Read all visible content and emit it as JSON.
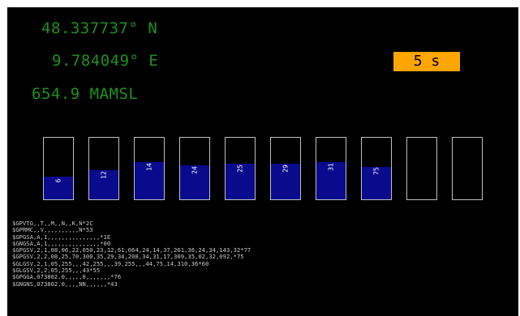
{
  "position": {
    "latitude": "48.337737° N",
    "longitude": "9.784049° E",
    "altitude": "654.9 MAMSL"
  },
  "timer": "5 s",
  "colors": {
    "background": "#000000",
    "coords": "#1f8f1f",
    "timer_bg": "#ffa500",
    "bar_fill": "#0a0a8c",
    "bar_border": "#bfbfbf",
    "nmea_text": "#c8c8c8"
  },
  "satellites": [
    {
      "label": "6",
      "level": 0.37
    },
    {
      "label": "12",
      "level": 0.47
    },
    {
      "label": "14",
      "level": 0.6
    },
    {
      "label": "24",
      "level": 0.55
    },
    {
      "label": "25",
      "level": 0.58
    },
    {
      "label": "29",
      "level": 0.58
    },
    {
      "label": "31",
      "level": 0.6
    },
    {
      "label": "75",
      "level": 0.53
    },
    {
      "label": "",
      "level": 0
    },
    {
      "label": "",
      "level": 0
    }
  ],
  "nmea": [
    "$GPVTG,,T,,M,,N,,K,N*2C",
    "$GPRMC,,V,,,,,,,,,,N*53",
    "$GPGSA,A,1,,,,,,,,,,,,,,,*1E",
    "$GNGSA,A,1,,,,,,,,,,,,,,,*00",
    "$GPGSV,2,1,08,06,22,050,23,12,61,064,24,14,37,261,36,24,34,143,32*77",
    "$GPGSV,2,2,08,25,70,300,35,29,34,208,34,31,17,309,35,02,32,092,*75",
    "$GLGSV,2,1,05,255,,,42,255,,,39,255,,,44,75,14,310,36*60",
    "$GLGSV,2,2,05,255,,,43*55",
    "$GPGGA,073802.0,,,,,0,,,,,,,*76",
    "$GNGNS,073802.0,,,,NN,,,,,,*43"
  ]
}
